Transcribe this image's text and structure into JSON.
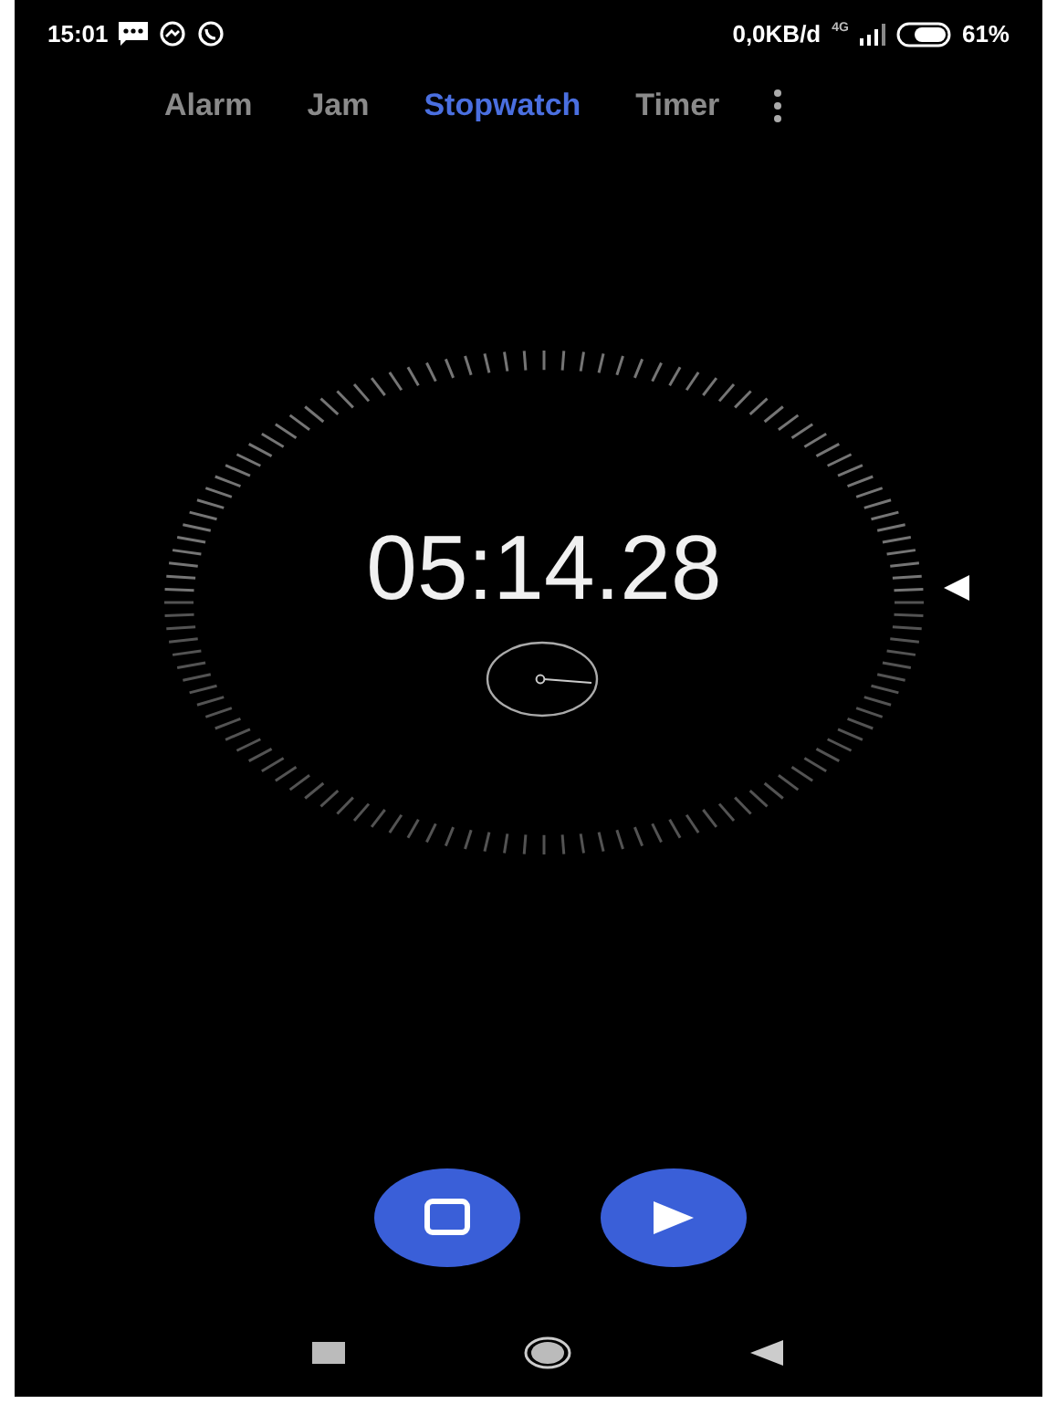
{
  "status_bar": {
    "time": "15:01",
    "data_rate": "0,0KB/d",
    "network": "4G",
    "battery": "61%"
  },
  "tabs": [
    {
      "label": "Alarm",
      "selected": false
    },
    {
      "label": "Jam",
      "selected": false
    },
    {
      "label": "Stopwatch",
      "selected": true
    },
    {
      "label": "Timer",
      "selected": false
    }
  ],
  "stopwatch": {
    "elapsed": "05:14.28"
  },
  "buttons": [
    {
      "kind": "reset"
    },
    {
      "kind": "start"
    }
  ]
}
